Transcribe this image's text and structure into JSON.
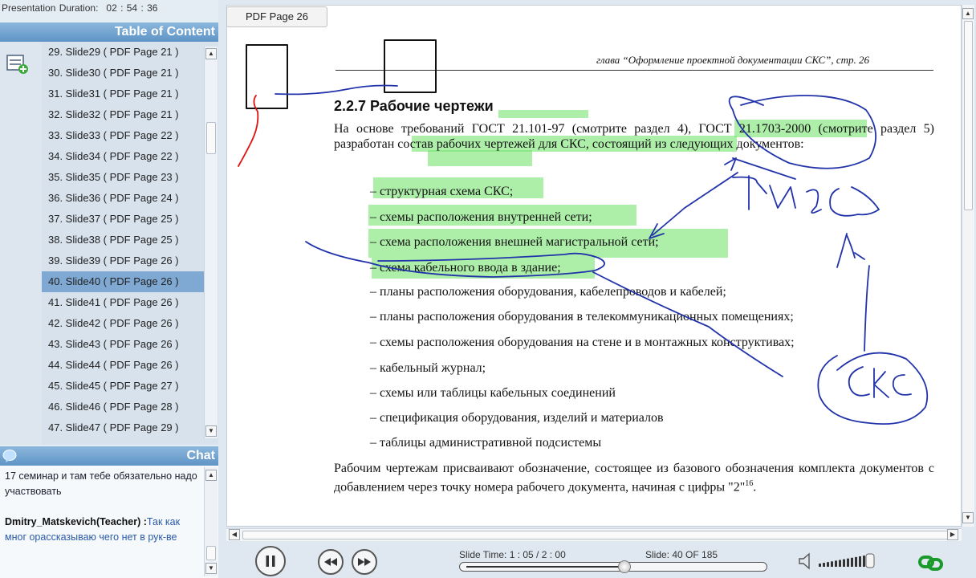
{
  "presentation": {
    "duration_label": "Presentation Duration:",
    "duration_value": "02 : 54 : 36"
  },
  "toc": {
    "title": "Table of Content",
    "selected_fraction": "",
    "items": [
      "29. Slide29 ( PDF Page 21 )",
      "30. Slide30 ( PDF Page 21 )",
      "31. Slide31 ( PDF Page 21 )",
      "32. Slide32 ( PDF Page 21 )",
      "33. Slide33 ( PDF Page 22 )",
      "34. Slide34 ( PDF Page 22 )",
      "35. Slide35 ( PDF Page 23 )",
      "36. Slide36 ( PDF Page 24 )",
      "37. Slide37 ( PDF Page 25 )",
      "38. Slide38 ( PDF Page 25 )",
      "39. Slide39 ( PDF Page 26 )",
      "40. Slide40 ( PDF Page 26 )",
      "41. Slide41 ( PDF Page 26 )",
      "42. Slide42 ( PDF Page 26 )",
      "43. Slide43 ( PDF Page 26 )",
      "44. Slide44 ( PDF Page 26 )",
      "45. Slide45 ( PDF Page 27 )",
      "46. Slide46 ( PDF Page 28 )",
      "47. Slide47 ( PDF Page 29 )"
    ],
    "selected_index": 11
  },
  "chat": {
    "title": "Chat",
    "line1": "17 семинар и там тебе обязательно надо участвовать",
    "teacher": "Dmitry_Matskevich(Teacher) :",
    "message": "Так как мног орассказываю чего нет в рук-ве"
  },
  "viewer": {
    "page_tab": "PDF Page 26",
    "running_head": "глава “Оформление проектной документации СКС”, стр. 26",
    "section_title": "2.2.7  Рабочие чертежи",
    "intro": "На основе требований ГОСТ 21.101-97 (смотрите раздел 4), ГОСТ 21.1703-2000 (смотрите раздел 5) разработан состав рабочих чертежей для СКС, состоящий из следующих документов:",
    "items": [
      "– структурная схема СКС;",
      "– схемы расположения внутренней сети;",
      "– схема расположения внешней магистральной сети;",
      "– схема кабельного ввода в здание;",
      "– планы расположения оборудования, кабелепроводов и кабелей;",
      "– планы расположения оборудования в телекоммуникационных помещениях;",
      "– схемы расположения оборудования на стене и в монтажных конструктивах;",
      "– кабельный журнал;",
      "– схемы или таблицы кабельных соединений",
      "– спецификация оборудования, изделий и материалов",
      "– таблицы административной подсистемы"
    ],
    "outro": "Рабочим чертежам присваивают обозначение, состоящее из базового обозначения комплекта документов с добавлением через точку номера рабочего документа, начиная с цифры \"2\"",
    "outro_sup": "16",
    "outro_end": "."
  },
  "player": {
    "slide_time": "Slide Time:  1 : 05 / 2 : 00",
    "slide_label": "Slide:   40 OF 185",
    "progress": 0.54,
    "volume_level": 0.85
  },
  "colors": {
    "accent": "#5f94c6",
    "highlight": "#76e26f",
    "ink_blue": "#2233aa",
    "ink_red": "#dd1111"
  }
}
